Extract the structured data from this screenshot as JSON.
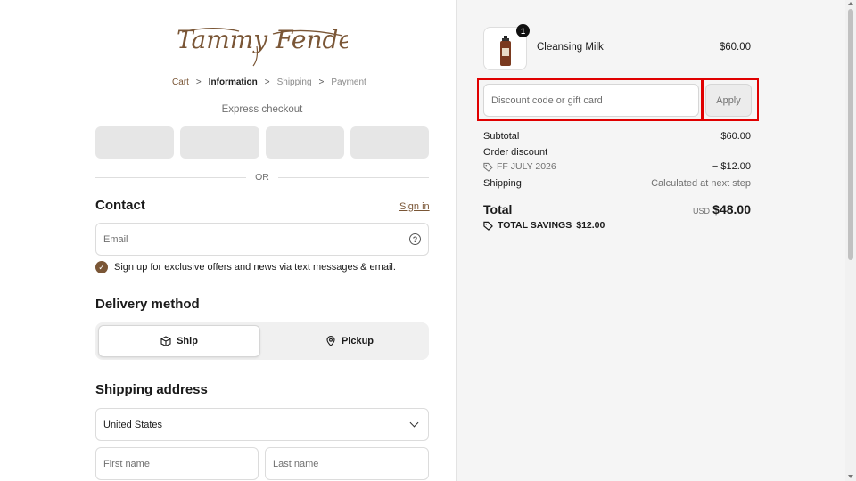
{
  "brand": {
    "logo_text": "Tammy Fender"
  },
  "breadcrumb": {
    "items": [
      {
        "label": "Cart"
      },
      {
        "label": "Information"
      },
      {
        "label": "Shipping"
      },
      {
        "label": "Payment"
      }
    ],
    "separator": ">"
  },
  "express": {
    "label": "Express checkout",
    "or_label": "OR"
  },
  "contact": {
    "title": "Contact",
    "sign_in": "Sign in",
    "email_placeholder": "Email",
    "help_symbol": "?",
    "marketing_label": "Sign up for exclusive offers and news via text messages & email.",
    "marketing_checked": true
  },
  "delivery": {
    "title": "Delivery method",
    "options": [
      {
        "label": "Ship",
        "icon": "box-icon",
        "selected": true
      },
      {
        "label": "Pickup",
        "icon": "location-pin-icon",
        "selected": false
      }
    ]
  },
  "shipping_address": {
    "title": "Shipping address",
    "country": "United States",
    "first_name_placeholder": "First name",
    "last_name_placeholder": "Last name"
  },
  "order": {
    "item": {
      "name": "Cleansing Milk",
      "price": "$60.00",
      "quantity": "1"
    },
    "discount_placeholder": "Discount code or gift card",
    "apply_label": "Apply",
    "subtotal_label": "Subtotal",
    "subtotal_value": "$60.00",
    "order_discount_label": "Order discount",
    "discount_code": "FF JULY 2026",
    "discount_value": "− $12.00",
    "shipping_label": "Shipping",
    "shipping_value": "Calculated at next step",
    "total_label": "Total",
    "total_currency": "USD",
    "total_value": "$48.00",
    "savings_label": "TOTAL SAVINGS",
    "savings_value": "$12.00"
  },
  "colors": {
    "accent": "#7a5636",
    "highlight": "#e00000",
    "summary_bg": "#f5f5f5"
  }
}
